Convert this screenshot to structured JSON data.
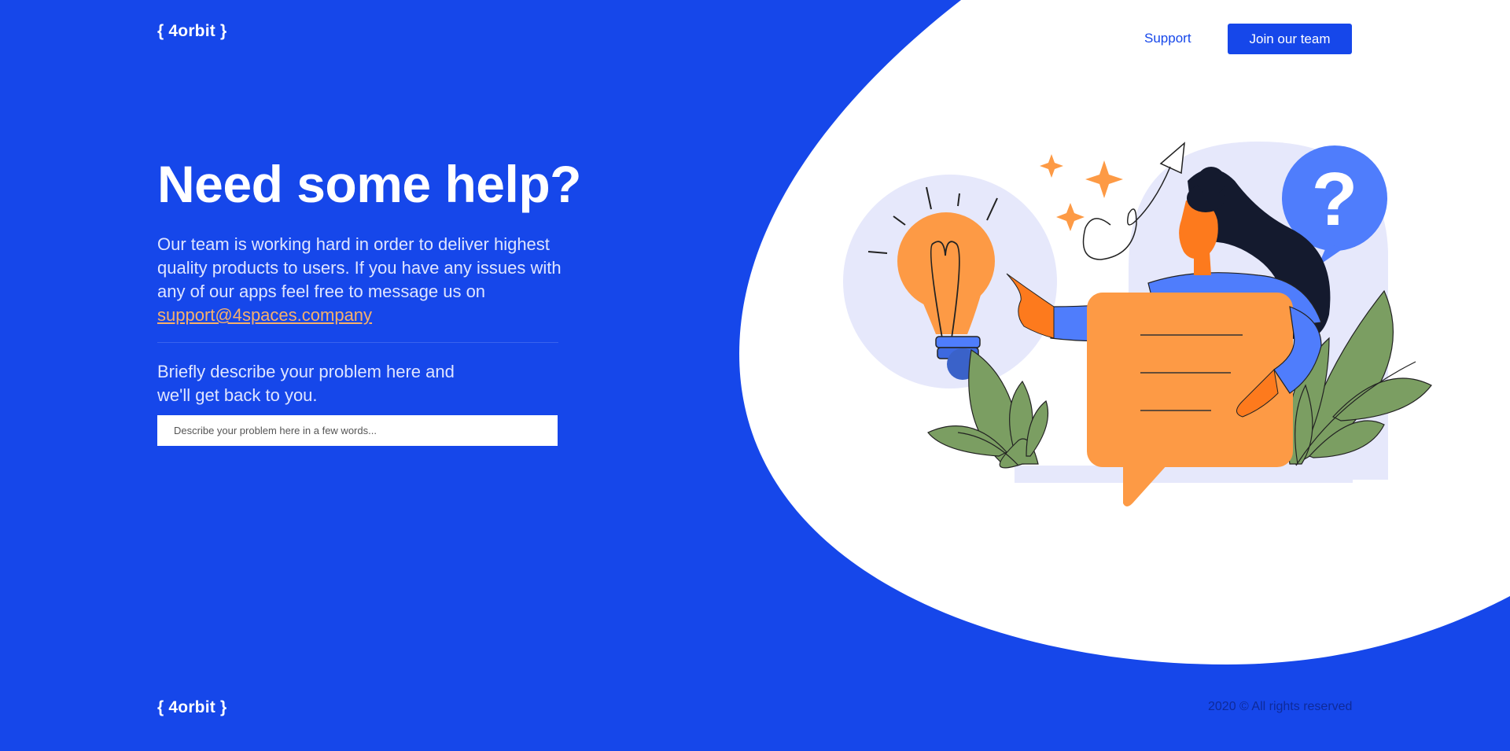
{
  "brand": {
    "logo_text": "{ 4orbit }"
  },
  "header": {
    "support_link": "Support",
    "join_button": "Join our team"
  },
  "hero": {
    "title": "Need some help?",
    "description": "Our team is working hard in order to deliver highest quality products to users. If you have any issues with any of our apps feel free to message us on",
    "email": "support@4spaces.company",
    "prompt": "Briefly describe your problem here and we'll get back to you.",
    "input_placeholder": "Describe your problem here in a few words...",
    "input_value": ""
  },
  "footer": {
    "logo_text": "{ 4orbit }",
    "copyright": "2020 © All rights reserved"
  },
  "colors": {
    "brand_blue": "#1647ea",
    "accent_orange": "#fd9a45",
    "leaf_green": "#7b9e62",
    "question_blue": "#4f7dfc",
    "soft_lavender": "#e6e8fb",
    "text_light": "#dfe5ff"
  },
  "illustration": {
    "icons": [
      "lightbulb-icon",
      "question-mark-icon",
      "sparkle-icon",
      "paper-plane-icon",
      "speech-bubble-icon",
      "leaf-icon"
    ]
  }
}
